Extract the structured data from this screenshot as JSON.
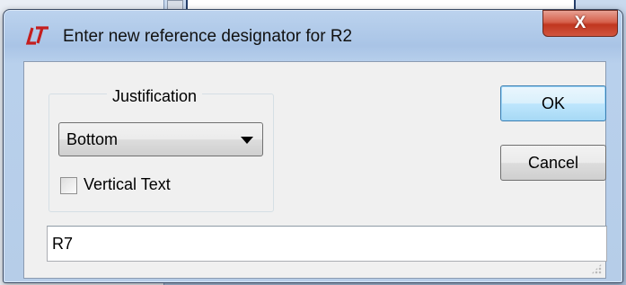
{
  "window": {
    "title": "Enter new reference designator for R2",
    "close_label": "X"
  },
  "justification": {
    "legend": "Justification",
    "selected": "Bottom",
    "vertical_text_label": "Vertical Text",
    "vertical_text_checked": false
  },
  "buttons": {
    "ok_label": "OK",
    "cancel_label": "Cancel"
  },
  "designator": {
    "value": "R7"
  },
  "colors": {
    "accent": "#3c7fb1",
    "close_button": "#c0361f",
    "icon": "#c41e1e"
  }
}
